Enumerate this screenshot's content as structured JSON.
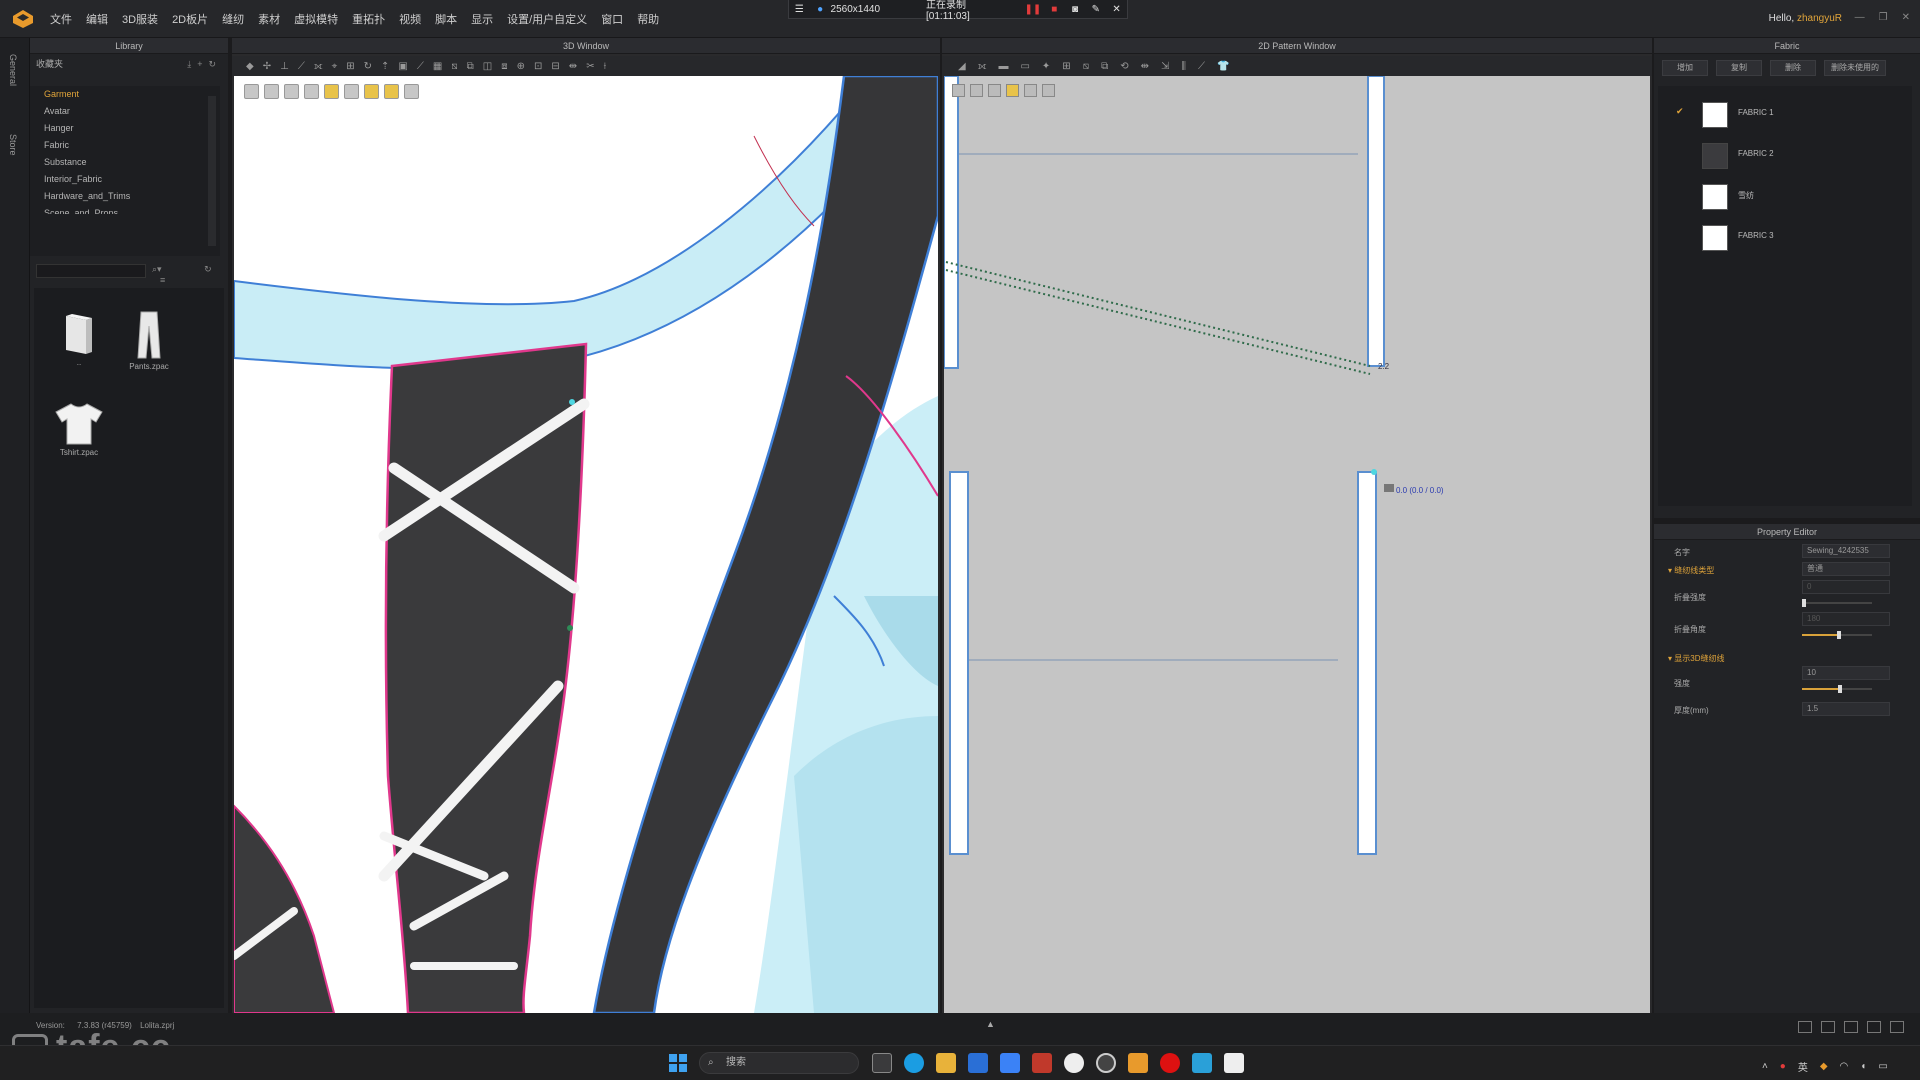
{
  "menubar": {
    "items": [
      "文件",
      "编辑",
      "3D服装",
      "2D板片",
      "缝纫",
      "素材",
      "虚拟模特",
      "重拓扑",
      "视频",
      "脚本",
      "显示",
      "设置/用户自定义",
      "窗口",
      "帮助"
    ],
    "greeting": "Hello, ",
    "user": "zhangyuR"
  },
  "recording": {
    "resolution": "2560x1440",
    "status": "正在录制 [01:11:03]",
    "accent": "#e23b3b"
  },
  "side_strip": {
    "top": "General",
    "bottom": "Store"
  },
  "library": {
    "title": "Library",
    "subtitle": "收藏夹",
    "tree": [
      "Garment",
      "Avatar",
      "Hanger",
      "Fabric",
      "Substance",
      "Interior_Fabric",
      "Hardware_and_Trims",
      "Scene_and_Props"
    ],
    "items": [
      {
        "label": "..",
        "icon": "folder-icon"
      },
      {
        "label": "Pants.zpac",
        "icon": "pants-icon"
      },
      {
        "label": "Tshirt.zpac",
        "icon": "tshirt-icon"
      }
    ]
  },
  "view3d": {
    "title": "3D Window"
  },
  "view2d": {
    "title": "2D Pattern Window",
    "label_a": "2.2",
    "readout": "0.0 (0.0 / 0.0)"
  },
  "fabric": {
    "title": "Fabric",
    "buttons": [
      "增加",
      "复制",
      "删除",
      "删除未使用的"
    ],
    "items": [
      {
        "name": "FABRIC 1",
        "checked": true,
        "swatch": "#ffffff"
      },
      {
        "name": "FABRIC 2",
        "checked": false,
        "swatch": "#3b3b3e"
      },
      {
        "name": "雪纺",
        "checked": false,
        "swatch": "#ffffff"
      },
      {
        "name": "FABRIC 3",
        "checked": false,
        "swatch": "#ffffff"
      }
    ]
  },
  "property": {
    "title": "Property Editor",
    "name_label": "名字",
    "name_value": "Sewing_4242535",
    "section_type": "缝纫线类型",
    "type_value": "普通",
    "fold_strength": "折叠强度",
    "fold_strength_value": "0",
    "fold_angle": "折叠角度",
    "fold_angle_value": "180",
    "section_3d": "显示3D缝纫线",
    "strength": "强度",
    "strength_value": "10",
    "thickness": "厚度(mm)",
    "thickness_value": "1.5"
  },
  "status": {
    "version_label": "Version:",
    "version": "7.3.83 (r45759)",
    "file": "Lolita.zprj"
  },
  "watermark": "tafe.cc",
  "taskbar": {
    "search": "搜索",
    "ime": "英"
  },
  "colors": {
    "accent": "#e0a43a",
    "seam_blue": "#3f7fd6",
    "seam_pink": "#e0388c",
    "fabric_light_blue": "#c9edf6",
    "fabric_dark": "#3a3a3c"
  }
}
